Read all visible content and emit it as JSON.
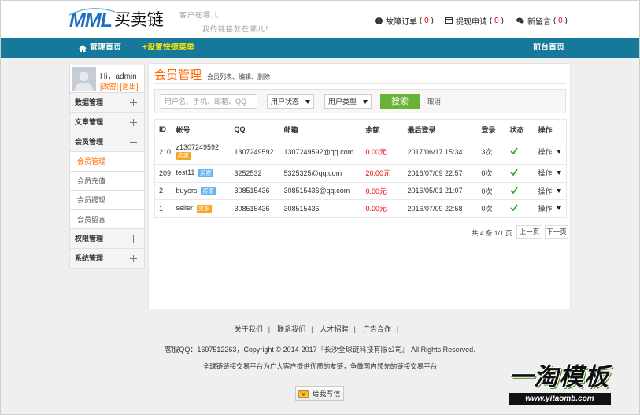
{
  "header": {
    "logo_mark": "MML",
    "logo_name": "买卖链",
    "slogan_line1": "客户在哪儿",
    "slogan_line2": "我的链接就在哪儿!",
    "notices": [
      {
        "icon": "warning-icon",
        "label": "故障订单",
        "count": "0"
      },
      {
        "icon": "card-icon",
        "label": "提现申请",
        "count": "0"
      },
      {
        "icon": "chat-icon",
        "label": "新留言",
        "count": "0"
      }
    ]
  },
  "nav": {
    "home_icon": "home-icon",
    "home": "管理首页",
    "shortcut": "+设置快捷菜单",
    "frontend": "前台首页"
  },
  "sidebar": {
    "greeting": "Hi，admin",
    "change_password": "[改密]",
    "logout": "[退出]",
    "menus": [
      {
        "label": "数据管理",
        "icon": "plus-icon"
      },
      {
        "label": "文章管理",
        "icon": "plus-icon"
      },
      {
        "label": "会员管理",
        "icon": "minus-icon",
        "expanded": true,
        "children": [
          {
            "label": "会员管理",
            "active": true
          },
          {
            "label": "会员充值"
          },
          {
            "label": "会员提现"
          },
          {
            "label": "会员留言"
          }
        ]
      },
      {
        "label": "权限管理",
        "icon": "plus-icon"
      },
      {
        "label": "系统管理",
        "icon": "plus-icon"
      }
    ]
  },
  "main": {
    "title": "会员管理",
    "subtitle": "会员列表、编辑、删除",
    "search": {
      "placeholder": "用户名、手机、邮箱、QQ",
      "value": "",
      "status_select": "用户状态",
      "type_select": "用户类型",
      "search_button": "搜索",
      "cancel": "取消"
    },
    "table": {
      "columns": [
        "ID",
        "帐号",
        "QQ",
        "邮箱",
        "余额",
        "最后登录",
        "登录",
        "状态",
        "操作"
      ],
      "rows": [
        {
          "id": "210",
          "account": "z1307249592",
          "type": "卖家",
          "qq": "1307249592",
          "email": "1307249592@qq.com",
          "balance": "0.00元",
          "last_login": "2017/06/17 15:34",
          "logins": "3次",
          "status_icon": "check-icon",
          "action": "操作"
        },
        {
          "id": "209",
          "account": "test11",
          "type": "买家",
          "qq": "3252532",
          "email": "5325325@qq.com",
          "balance": "20.00元",
          "last_login": "2016/07/09 22:57",
          "logins": "0次",
          "status_icon": "check-icon",
          "action": "操作"
        },
        {
          "id": "2",
          "account": "buyers",
          "type": "买家",
          "qq": "308515436",
          "email": "308515436@qq.com",
          "balance": "0.00元",
          "last_login": "2016/05/01 21:07",
          "logins": "0次",
          "status_icon": "check-icon",
          "action": "操作"
        },
        {
          "id": "1",
          "account": "seller",
          "type": "卖家",
          "qq": "308515436",
          "email": "308515436",
          "balance": "0.00元",
          "last_login": "2016/07/09 22:58",
          "logins": "0次",
          "status_icon": "check-icon",
          "action": "操作"
        }
      ]
    },
    "pager": {
      "summary": "共 4 条 1/1 页",
      "prev": "上一页",
      "next": "下一页"
    }
  },
  "footer": {
    "links": [
      "关于我们",
      "联系我们",
      "人才招聘",
      "广告合作"
    ],
    "copyright": "客服QQ：1697512263，Copyright © 2014-2017『长沙全球链科技有限公司』 All Rights Reserved.",
    "slogan": "全球链链接交易平台为广大客户提供优质的友链，争做国内领先的链接交易平台",
    "mail_button": "给我写信",
    "mail_icon": "envelope-icon"
  },
  "watermark": {
    "text": "一淘模板",
    "url": "www.yitaomb.com"
  },
  "colors": {
    "accent": "#ff6600",
    "nav": "#16789a",
    "shortcut": "#ffe600",
    "search_button": "#68b234",
    "balance": "#e40000",
    "seller_badge": "#f5a623",
    "buyer_badge": "#5cb5ee",
    "status_check": "#2ea52e"
  }
}
